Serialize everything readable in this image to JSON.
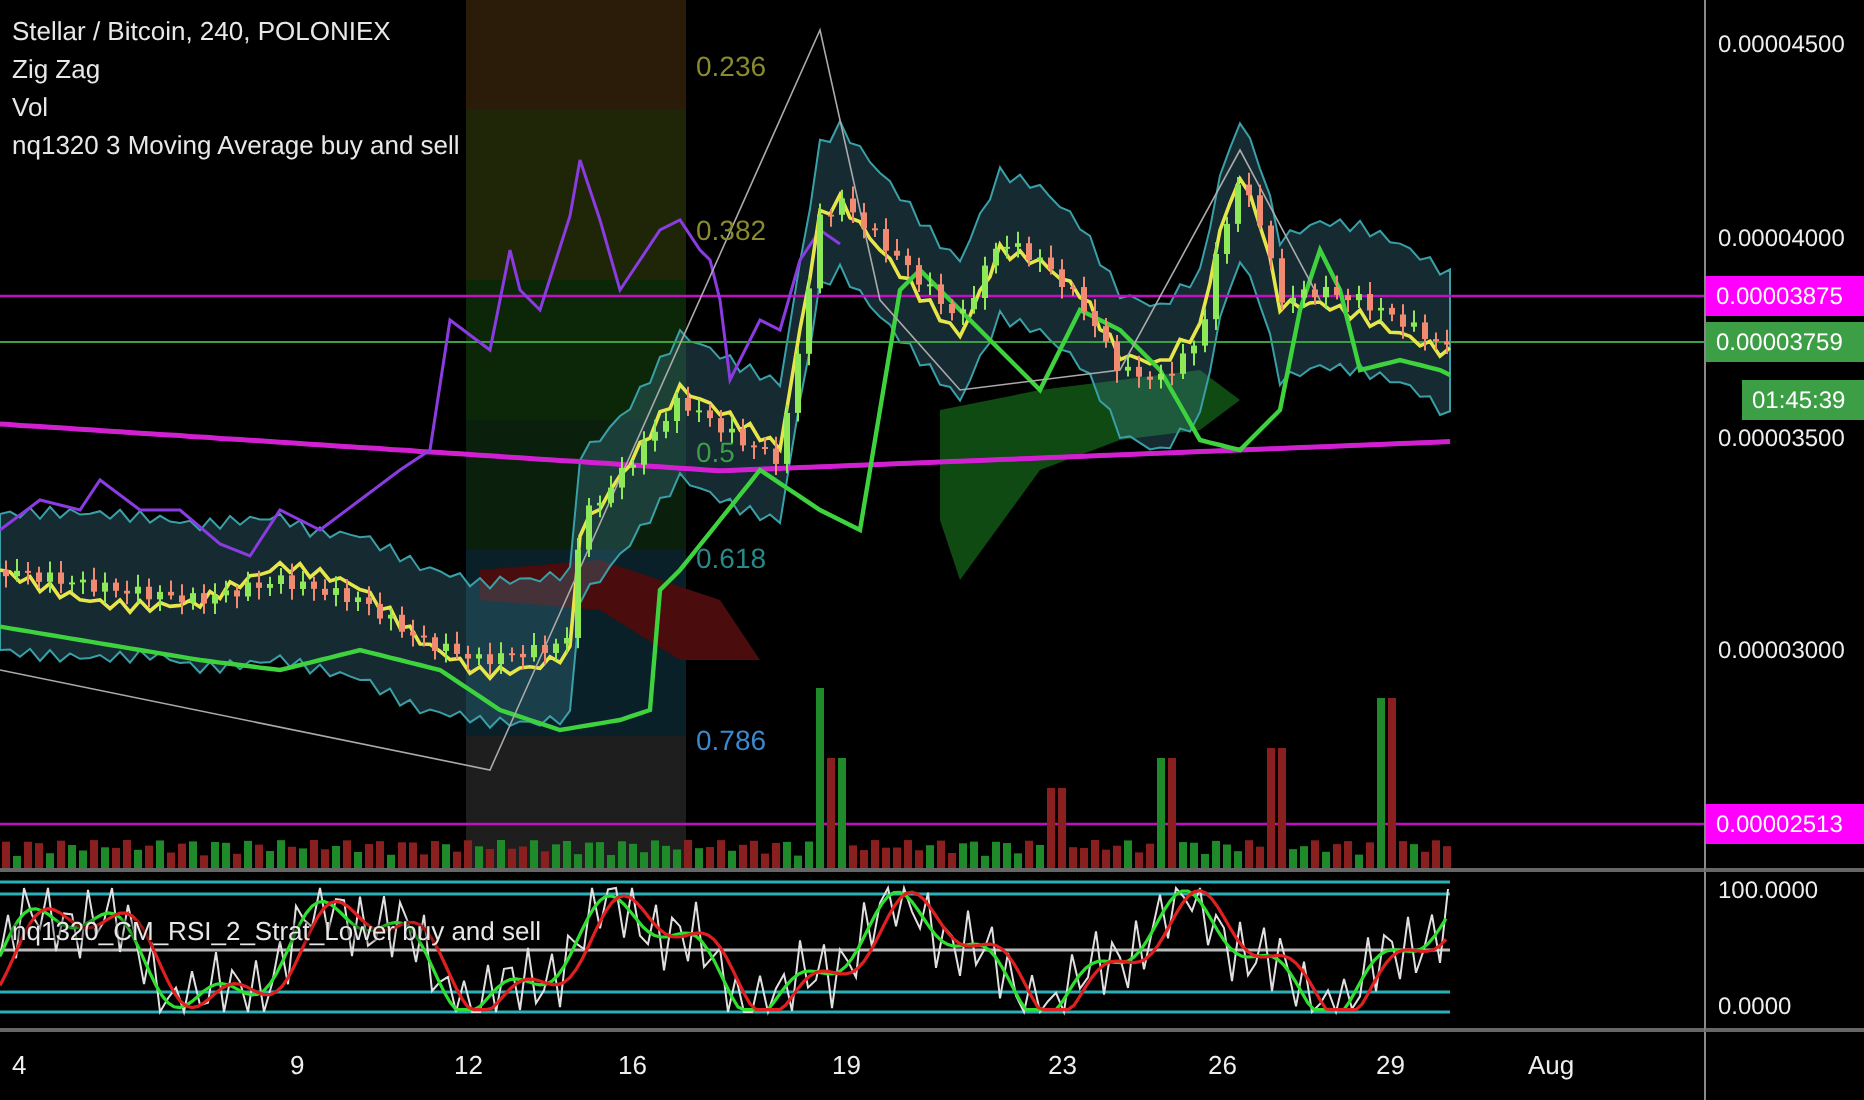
{
  "legend": {
    "symbol": "Stellar / Bitcoin, 240, POLONIEX",
    "indicators": [
      "Zig Zag",
      "Vol",
      "nq1320 3 Moving Average buy and sell"
    ]
  },
  "fib_levels": [
    "0.236",
    "0.382",
    "0.5",
    "0.618",
    "0.786"
  ],
  "price_axis": {
    "ticks": [
      "0.00004500",
      "0.00004000",
      "0.00003500",
      "0.00003000"
    ],
    "badges": [
      {
        "text": "0.00003875",
        "color": "#ff00ff"
      },
      {
        "text": "0.00003759",
        "color": "#3c9e45"
      },
      {
        "text": "01:45:39",
        "color": "#3c9e45"
      },
      {
        "text": "0.00002513",
        "color": "#ff00ff"
      }
    ]
  },
  "lower_pane": {
    "title": "nq1320_CM_RSI_2_Strat_Lower buy and sell",
    "axis_ticks": [
      "100.0000",
      "0.0000"
    ]
  },
  "time_axis": [
    "4",
    "9",
    "12",
    "16",
    "19",
    "23",
    "26",
    "29",
    "Aug"
  ]
}
